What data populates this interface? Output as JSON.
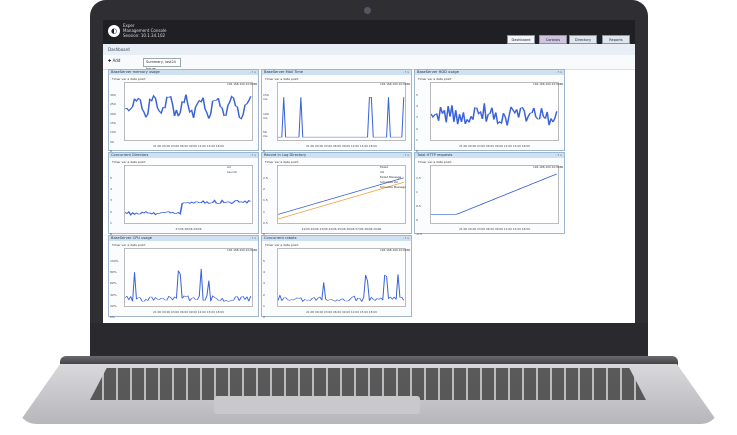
{
  "app": {
    "brand_line1": "Exper",
    "brand_line2": "Management Console",
    "brand_line3": "Session: 10.1.34.102",
    "tabs": [
      {
        "label": "Dashboard"
      },
      {
        "label": "Controls"
      },
      {
        "label": "Directory"
      },
      {
        "label": "Reports"
      }
    ]
  },
  "toolbar": {
    "title": "Dashboard",
    "add_label": "Add",
    "range_value": "Summary, last24 hours",
    "panel_controls": "- ? x"
  },
  "panels": [
    {
      "title": "BaseServer memory usage",
      "meta": "Timer var a data point",
      "y_labels": [
        "300",
        "250",
        "200",
        "150",
        "100",
        "50",
        "0"
      ],
      "x_label": "21:00 00:00 03:00 06:00 09:00 12:00 15:00 18:00",
      "legend": [
        "192.168.100.10:8080"
      ],
      "color": "#3a63d8"
    },
    {
      "title": "BaseServer Mail Time",
      "meta": "Timer var a data point",
      "y_labels": [
        "150 ms",
        "100 ms",
        "50 ms",
        "0 ms"
      ],
      "x_label": "21:00 00:00 03:00 06:00 09:00 12:00 15:00 18:00",
      "legend": [
        "192.168.100.10:8080"
      ],
      "color": "#3a63d8"
    },
    {
      "title": "BaseServer HDD usage",
      "meta": "Timer var a data point",
      "y_labels": [
        "5",
        "4",
        "3",
        "2",
        "1",
        "0"
      ],
      "x_label": "21:00 00:00 03:00 06:00 09:00 12:00 15:00 18:00",
      "legend": [
        "192.168.100.10:8080"
      ],
      "color": "#3a63d8"
    },
    {
      "title": "Concurrent Directors",
      "meta": "Timer var a data point",
      "y_labels": [
        "5",
        "4",
        "3",
        "2",
        "1",
        "0"
      ],
      "x_label": "27/06    28/06    29/06",
      "legend": [
        "All",
        "Launch"
      ],
      "color": "#3a63d8"
    },
    {
      "title": "Record in Log Directory",
      "meta": "Timer var a data point",
      "y_labels": [
        "2.5",
        "2",
        "1.5",
        "1",
        "0.5",
        "0"
      ],
      "x_label": "21/06 22/06 23/06 24/06 25/06 26/06 27/06 28/06 29/06",
      "legend": [
        "Failed",
        "Vol",
        "Failed Message",
        "Schedule Vol",
        "Schedule Message"
      ],
      "color": "#3a63d8"
    },
    {
      "title": "Total HTTP requests",
      "meta": "Timer var a data point",
      "y_labels": [
        "1.5",
        "1",
        "0.5",
        "0",
        "-0.5"
      ],
      "x_label": "21:00 00:00 03:00 06:00 09:00 12:00 15:00 18:00",
      "legend": [
        "192.168.100.10:8080"
      ],
      "color": "#3a63d8"
    },
    {
      "title": "BaseServer CPU usage",
      "meta": "Timer var a data point",
      "y_labels": [
        "100%",
        "80%",
        "60%",
        "40%",
        "20%",
        "0%"
      ],
      "x_label": "21:00 00:00 03:00 06:00 09:00 12:00 15:00 18:00",
      "legend": [
        "192.168.100.10:8080"
      ],
      "color": "#3a63d8"
    },
    {
      "title": "Concurrent robots",
      "meta": "Timer var a data point",
      "y_labels": [
        "5",
        "4",
        "3",
        "2",
        "1",
        "0"
      ],
      "x_label": "21:00 00:00 03:00 06:00 09:00 12:00 15:00 18:00",
      "legend": [
        "192.168.100.10:8080"
      ],
      "color": "#3a63d8"
    }
  ]
}
